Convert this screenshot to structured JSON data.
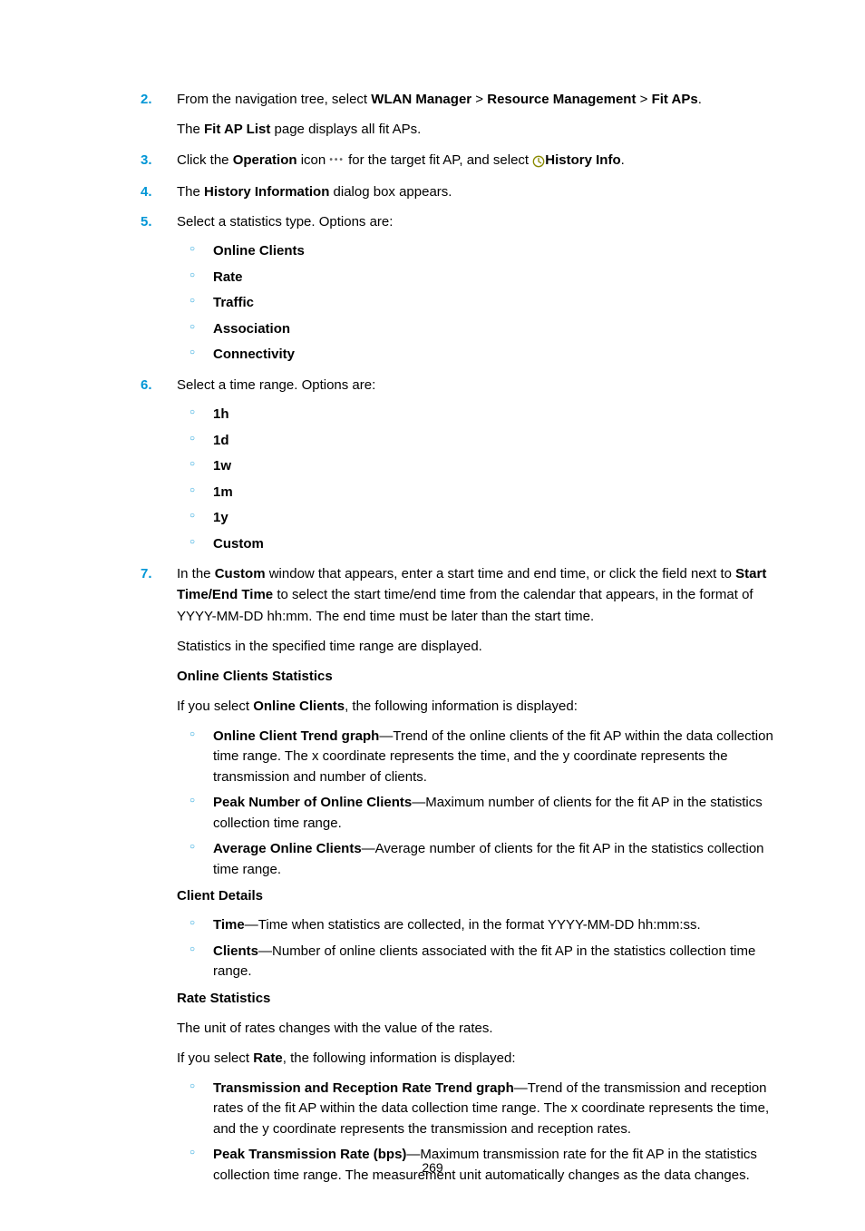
{
  "steps": {
    "s2": {
      "num": "2.",
      "p1a": "From the navigation tree, select ",
      "p1b": "WLAN Manager",
      "p1c": " > ",
      "p1d": "Resource Management",
      "p1e": " > ",
      "p1f": "Fit APs",
      "p1g": ".",
      "p2a": "The ",
      "p2b": "Fit AP List",
      "p2c": " page displays all fit APs."
    },
    "s3": {
      "num": "3.",
      "a": "Click the ",
      "b": "Operation",
      "c": " icon ",
      "d": " for the target fit AP, and select ",
      "e": "History Info",
      "f": "."
    },
    "s4": {
      "num": "4.",
      "a": "The ",
      "b": "History Information",
      "c": " dialog box appears."
    },
    "s5": {
      "num": "5.",
      "text": "Select a statistics type. Options are:",
      "opts": [
        "Online Clients",
        "Rate",
        "Traffic",
        "Association",
        "Connectivity"
      ]
    },
    "s6": {
      "num": "6.",
      "text": "Select a time range. Options are:",
      "opts": [
        "1h",
        "1d",
        "1w",
        "1m",
        "1y",
        "Custom"
      ]
    },
    "s7": {
      "num": "7.",
      "p1a": "In the ",
      "p1b": "Custom",
      "p1c": " window that appears, enter a start time and end time, or click the field next to ",
      "p1d": "Start Time/End Time",
      "p1e": " to select the start time/end time from the calendar that appears, in the format of YYYY-MM-DD hh:mm. The end time must be later than the start time.",
      "p2": "Statistics in the specified time range are displayed.",
      "h1": "Online Clients Statistics",
      "p3a": "If you select ",
      "p3b": "Online Clients",
      "p3c": ", the following information is displayed:",
      "oc": [
        {
          "b": "Online Client Trend graph",
          "t": "—Trend of the online clients of the fit AP within the data collection time range. The x coordinate represents the time, and the y coordinate represents the transmission and number of clients."
        },
        {
          "b": "Peak Number of Online Clients",
          "t": "—Maximum number of clients for the fit AP in the statistics collection time range."
        },
        {
          "b": "Average Online Clients",
          "t": "—Average number of clients for the fit AP in the statistics collection time range."
        }
      ],
      "h2": "Client Details",
      "cd": [
        {
          "b": "Time",
          "t": "—Time when statistics are collected, in the format YYYY-MM-DD hh:mm:ss."
        },
        {
          "b": "Clients",
          "t": "—Number of online clients associated with the fit AP in the statistics collection time range."
        }
      ],
      "h3": "Rate Statistics",
      "p4": "The unit of rates changes with the value of the rates.",
      "p5a": "If you select ",
      "p5b": "Rate",
      "p5c": ", the following information is displayed:",
      "rs": [
        {
          "b": "Transmission and Reception Rate Trend graph",
          "t": "—Trend of the transmission and reception rates of the fit AP within the data collection time range. The x coordinate represents the time, and the y coordinate represents the transmission and reception rates."
        },
        {
          "b": "Peak Transmission Rate (bps)",
          "t": "—Maximum transmission rate for the fit AP in the statistics collection time range. The measurement unit automatically changes as the data changes."
        }
      ]
    }
  },
  "pageNumber": "269"
}
